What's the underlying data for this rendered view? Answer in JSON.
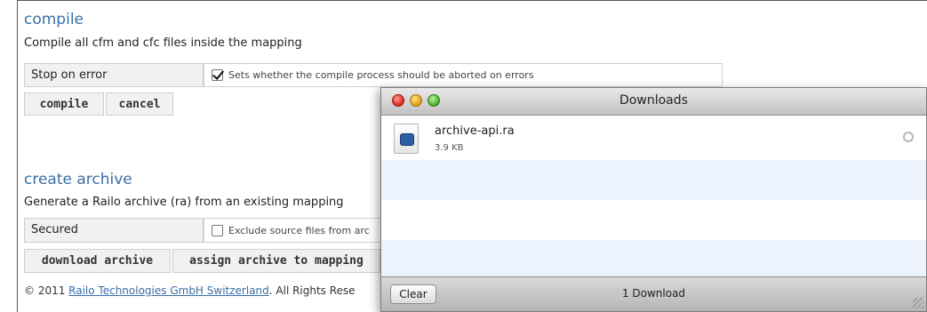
{
  "compile": {
    "title": "compile",
    "description": "Compile all cfm and cfc files inside the mapping",
    "option_label": "Stop on error",
    "option_text": "Sets whether the compile process should be aborted on errors",
    "option_checked": true,
    "compile_button": "compile",
    "cancel_button": "cancel"
  },
  "archive": {
    "title": "create archive",
    "description": "Generate a Railo archive (ra) from an existing mapping",
    "option_label": "Secured",
    "option_text": "Exclude source files from arc",
    "option_checked": false,
    "download_button": "download archive",
    "assign_button": "assign archive to mapping"
  },
  "footer": {
    "prefix": "© 2011 ",
    "link": "Railo Technologies GmbH Switzerland",
    "suffix": ". All Rights Rese"
  },
  "downloads": {
    "title": "Downloads",
    "items": [
      {
        "name": "archive-api.ra",
        "size": "3.9 KB"
      }
    ],
    "clear_label": "Clear",
    "count_label": "1 Download"
  }
}
